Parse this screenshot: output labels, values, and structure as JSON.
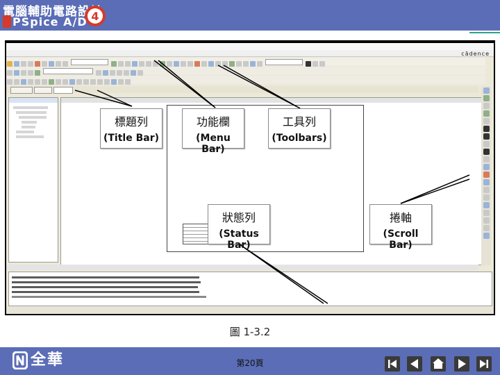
{
  "header": {
    "book_title": "電腦輔助電路設計",
    "book_subtitle": "PSpice A/D",
    "edition_text": "第4版",
    "edition_mark": "電腦"
  },
  "screenshot": {
    "app_logo": "cādence",
    "callouts": {
      "title_bar": {
        "zh": "標題列",
        "en": "(Title Bar)"
      },
      "menu_bar": {
        "zh": "功能欄",
        "en": "(Menu Bar)"
      },
      "toolbars": {
        "zh": "工具列",
        "en": "(Toolbars)"
      },
      "status_bar": {
        "zh": "狀態列",
        "en": "(Status Bar)"
      },
      "scroll_bar": {
        "zh": "捲軸",
        "en": "(Scroll Bar)"
      }
    }
  },
  "caption": "圖 1-3.2",
  "footer": {
    "publisher": "全華",
    "page": "第20頁",
    "nav": [
      "first-page",
      "previous-page",
      "home",
      "next-page",
      "last-page"
    ]
  },
  "colors": {
    "header_bg": "#5b6db6",
    "footer_bg": "#5b6db6",
    "edition_badge": "#d53a2a",
    "accent_line": "#2aa38c"
  }
}
